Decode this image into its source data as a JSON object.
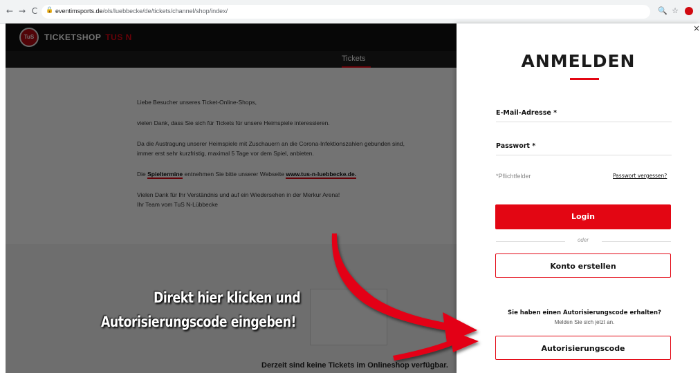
{
  "browser": {
    "back_glyph": "←",
    "forward_glyph": "→",
    "reload_glyph": "C",
    "lock_glyph": "🔒",
    "url_domain": "eventimsports.de",
    "url_path": "/ols/luebbecke/de/tickets/channel/shop/index/",
    "zoom_glyph": "🔍",
    "star_glyph": "☆",
    "icons": [
      "back-icon",
      "forward-icon",
      "reload-icon",
      "lock-icon",
      "zoom-icon",
      "star-icon",
      "extension-icon"
    ]
  },
  "site": {
    "logo_badge": "TuS",
    "logo_text": "TICKETSHOP",
    "logo_suffix": "TUS N",
    "nav_tickets": "Tickets",
    "accent": "#e30613"
  },
  "content": {
    "greeting": "Liebe Besucher unseres Ticket-Online-Shops,",
    "line1": "vielen Dank, dass Sie sich für Tickets für unsere Heimspiele interessieren.",
    "line2": "Da die Austragung unserer Heimspiele mit Zuschauern an die Corona-Infektionszahlen gebunden sind,",
    "line3": "immer erst sehr kurzfristig, maximal 5 Tage vor dem Spiel, anbieten.",
    "line4_pre": "Die",
    "line4_link1": "Spieltermine",
    "line4_mid": "entnehmen Sie bitte unserer Webseite",
    "line4_link2": "www.tus-n-luebbecke.de.",
    "thanks": "Vielen Dank für Ihr Verständnis und auf ein Wiedersehen in der Merkur Arena!",
    "signature": "Ihr Team vom TuS N-Lübbecke",
    "lower_text": "Derzeit sind keine Tickets im Onlineshop verfügbar."
  },
  "login": {
    "close_glyph": "×",
    "title": "ANMELDEN",
    "email_label": "E-Mail-Adresse *",
    "password_label": "Passwort *",
    "required_note": "*Pflichtfelder",
    "forgot_link": "Passwort vergessen?",
    "login_button": "Login",
    "or_text": "oder",
    "create_account_button": "Konto erstellen",
    "auth_question": "Sie haben einen Autorisierungscode erhalten?",
    "auth_sub": "Melden Sie sich jetzt an.",
    "auth_button": "Autorisierungscode"
  },
  "annotation": {
    "line1": "Direkt hier klicken und",
    "line2": "Autorisierungscode eingeben!",
    "arrow_color": "#e30613"
  }
}
